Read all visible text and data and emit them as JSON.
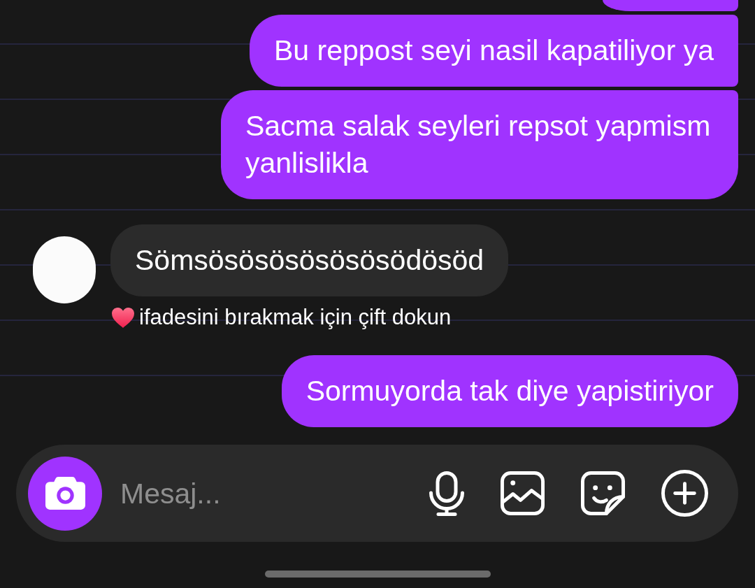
{
  "messages": [
    {
      "kind": "sent"
    },
    {
      "kind": "sent",
      "text": "Bu reppost seyi nasil kapatiliyor ya"
    },
    {
      "kind": "sent",
      "text": "Sacma salak seyleri repsot yapmism yanlislikla"
    },
    {
      "kind": "received",
      "text": "Sömsösösösösösösödösöd",
      "hint": "ifadesini bırakmak için çift dokun"
    },
    {
      "kind": "sent",
      "text": "Sormuyorda tak diye yapistiriyor"
    }
  ],
  "composer": {
    "placeholder": "Mesaj..."
  }
}
